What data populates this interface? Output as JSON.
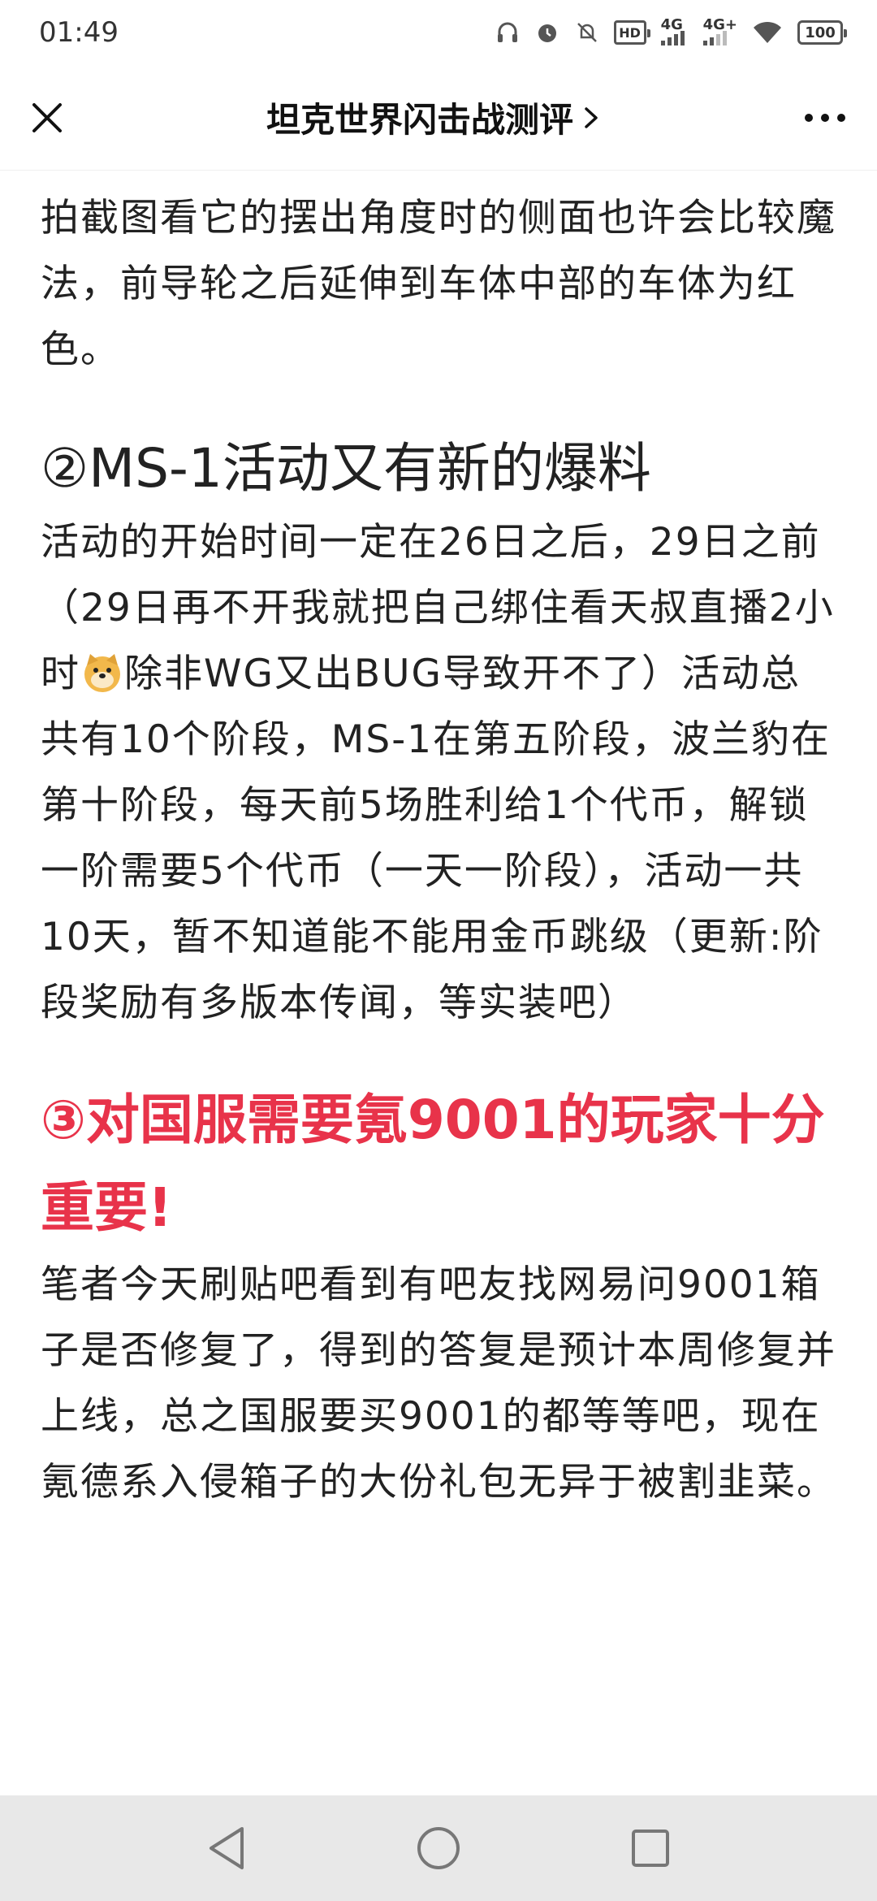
{
  "status_bar": {
    "time": "01:49",
    "net1": "4G",
    "net2": "4G+",
    "hd": "HD",
    "battery": "100"
  },
  "nav": {
    "title": "坦克世界闪击战测评",
    "chevron": ">"
  },
  "content": {
    "intro_paragraph": "拍截图看它的摆出角度时的侧面也许会比较魔法，前导轮之后延伸到车体中部的车体为红色。",
    "section2_heading": "②MS-1活动又有新的爆料",
    "section2_para_part1": "活动的开始时间一定在26日之后，29日之前（29日再不开我就把自己绑住看天叔直播2小时",
    "section2_para_part2": "除非WG又出BUG导致开不了）活动总共有10个阶段，MS-1在第五阶段，波兰豹在第十阶段，每天前5场胜利给1个代币，解锁一阶需要5个代币（一天一阶段），活动一共10天，暂不知道能不能用金币跳级（更新:阶段奖励有多版本传闻，等实装吧）",
    "section3_heading": "③对国服需要氪9001的玩家十分重要!",
    "section3_para": "笔者今天刷贴吧看到有吧友找网易问9001箱子是否修复了，得到的答复是预计本周修复并上线，总之国服要买9001的都等等吧，现在氪德系入侵箱子的大份礼包无异于被割韭菜。"
  },
  "colors": {
    "accent_red": "#e8334a",
    "text": "#222222",
    "bottom_bar": "#e8e8e8"
  },
  "icons": [
    "close-icon",
    "more-icon",
    "chevron-right-icon",
    "doge-emoji-icon",
    "back-nav-icon",
    "home-nav-icon",
    "recent-apps-icon"
  ]
}
